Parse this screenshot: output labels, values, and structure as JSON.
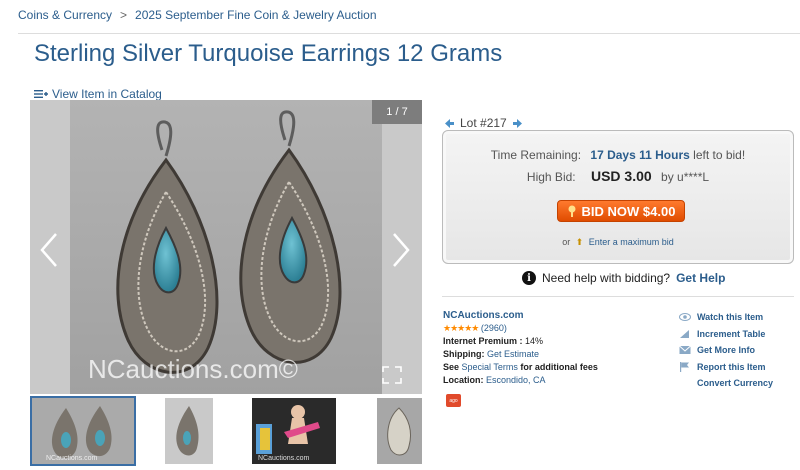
{
  "breadcrumb": {
    "items": [
      "Coins & Currency",
      "2025 September Fine Coin & Jewelry Auction"
    ],
    "separator": ">"
  },
  "title": "Sterling Silver Turquoise Earrings 12 Grams",
  "catalog_link": "View Item in Catalog",
  "viewer": {
    "counter": "1 / 7",
    "watermark": "NCauctions.com©",
    "thumb_watermarks": [
      "NCauctions.com",
      "NCauctions.com"
    ]
  },
  "lot": {
    "label": "Lot #217"
  },
  "bid": {
    "time_label": "Time Remaining:",
    "time_value": "17 Days 11 Hours",
    "time_suffix": "left to bid!",
    "high_label": "High Bid:",
    "high_amount": "USD 3.00",
    "high_by": "by u****L",
    "button": "BID NOW $4.00",
    "or_text": "or",
    "max_bid": "Enter a maximum bid"
  },
  "help": {
    "text": "Need help with bidding?",
    "link": "Get Help"
  },
  "seller": {
    "name": "NCAuctions.com",
    "stars": "★★★★★",
    "rating_count": "(2960)",
    "premium_label": "Internet Premium :",
    "premium_value": "14%",
    "shipping_label": "Shipping:",
    "shipping_link": "Get Estimate",
    "see_text": "See",
    "terms_link": "Special Terms",
    "terms_suffix": "for additional fees",
    "location_label": "Location:",
    "location_value": "Escondido, CA",
    "badge": "ago"
  },
  "actions": [
    "Watch this Item",
    "Increment Table",
    "Get More Info",
    "Report this Item",
    "Convert Currency"
  ],
  "colors": {
    "link": "#2b5d8c",
    "bid_button": "#f0621a",
    "stars": "#ff8a00"
  }
}
